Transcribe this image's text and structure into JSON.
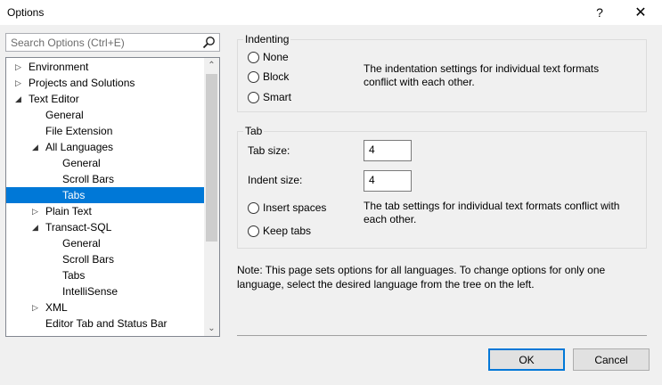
{
  "window": {
    "title": "Options",
    "help_label": "?",
    "close_label": "✕"
  },
  "search": {
    "placeholder": "Search Options (Ctrl+E)"
  },
  "tree": {
    "items": [
      {
        "label": "Environment",
        "arrow": "▷",
        "level": 0
      },
      {
        "label": "Projects and Solutions",
        "arrow": "▷",
        "level": 0
      },
      {
        "label": "Text Editor",
        "arrow": "◢",
        "level": 0
      },
      {
        "label": "General",
        "arrow": "",
        "level": 1
      },
      {
        "label": "File Extension",
        "arrow": "",
        "level": 1
      },
      {
        "label": "All Languages",
        "arrow": "◢",
        "level": 1
      },
      {
        "label": "General",
        "arrow": "",
        "level": 2
      },
      {
        "label": "Scroll Bars",
        "arrow": "",
        "level": 2
      },
      {
        "label": "Tabs",
        "arrow": "",
        "level": 2,
        "selected": true
      },
      {
        "label": "Plain Text",
        "arrow": "▷",
        "level": 1
      },
      {
        "label": "Transact-SQL",
        "arrow": "◢",
        "level": 1
      },
      {
        "label": "General",
        "arrow": "",
        "level": 2
      },
      {
        "label": "Scroll Bars",
        "arrow": "",
        "level": 2
      },
      {
        "label": "Tabs",
        "arrow": "",
        "level": 2
      },
      {
        "label": "IntelliSense",
        "arrow": "",
        "level": 2
      },
      {
        "label": "XML",
        "arrow": "▷",
        "level": 1
      },
      {
        "label": "Editor Tab and Status Bar",
        "arrow": "",
        "level": 1
      }
    ],
    "scroll_up": "⌃",
    "scroll_down": "⌄"
  },
  "indenting": {
    "label": "Indenting",
    "options": [
      "None",
      "Block",
      "Smart"
    ],
    "message": "The indentation settings for individual text formats conflict with each other."
  },
  "tab": {
    "label": "Tab",
    "tab_size_label": "Tab size:",
    "tab_size_value": "4",
    "indent_size_label": "Indent size:",
    "indent_size_value": "4",
    "options": [
      "Insert spaces",
      "Keep tabs"
    ],
    "message": "The tab settings for individual text formats conflict with each other."
  },
  "note": "Note: This page sets options for all languages. To change options for only one language, select the desired language from the tree on the left.",
  "buttons": {
    "ok": "OK",
    "cancel": "Cancel"
  },
  "colors": {
    "selection": "#0078d7",
    "background": "#f0f0f0"
  }
}
